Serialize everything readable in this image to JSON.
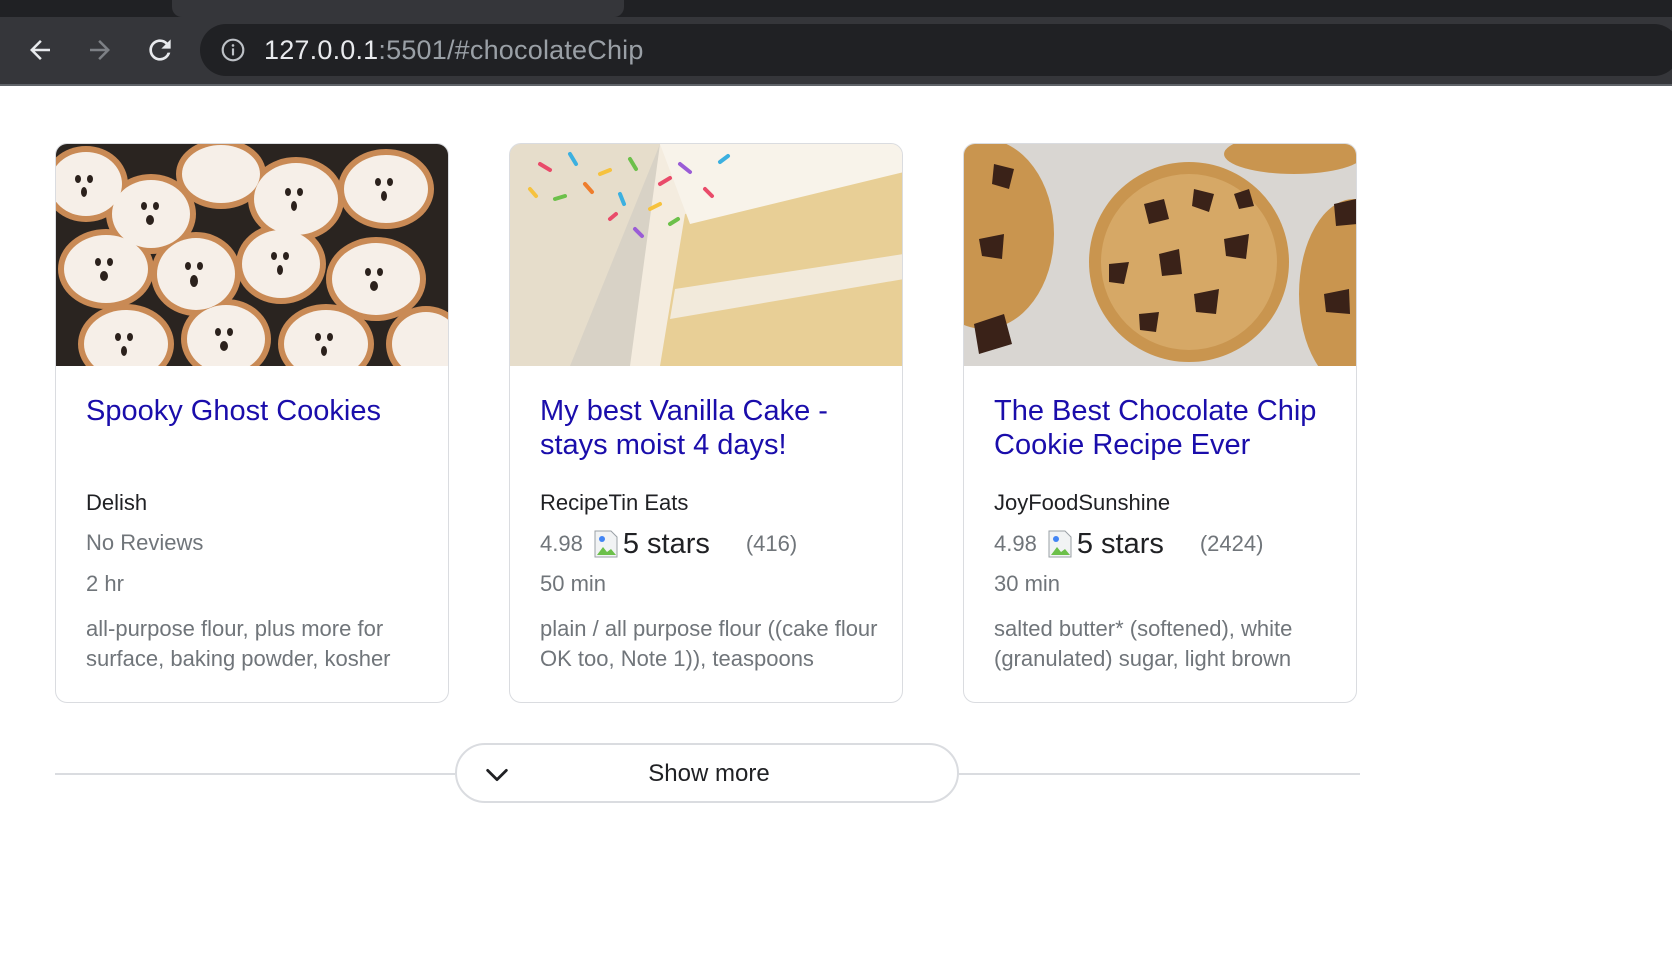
{
  "browser": {
    "url_host": "127.0.0.1",
    "url_rest": ":5501/#chocolateChip",
    "icons": {
      "back": "arrow-left-icon",
      "forward": "arrow-right-icon",
      "reload": "reload-icon",
      "site_info": "info-icon"
    }
  },
  "cards": [
    {
      "title": "Spooky Ghost Cookies",
      "source": "Delish",
      "reviews_text": "No Reviews",
      "time": "2 hr",
      "ingredients": "all-purpose flour, plus more for surface, baking powder, kosher",
      "image": "ghost-cookies-image"
    },
    {
      "title": "My best Vanilla Cake - stays moist 4 days!",
      "source": "RecipeTin Eats",
      "rating": "4.98",
      "stars_alt": "5 stars",
      "review_count": "(416)",
      "time": "50 min",
      "ingredients": "plain / all purpose flour ((cake flour OK too, Note 1)), teaspoons",
      "image": "vanilla-cake-image"
    },
    {
      "title": "The Best Chocolate Chip Cookie Recipe Ever",
      "source": "JoyFoodSunshine",
      "rating": "4.98",
      "stars_alt": "5 stars",
      "review_count": "(2424)",
      "time": "30 min",
      "ingredients": "salted butter* (softened), white (granulated) sugar, light brown",
      "image": "chocolate-chip-cookies-image"
    }
  ],
  "show_more": {
    "label": "Show more",
    "icon": "chevron-down-icon"
  },
  "colors": {
    "link": "#1a0dab",
    "secondary_text": "#70757a",
    "border": "#dadce0",
    "chrome_bg": "#35363a"
  }
}
